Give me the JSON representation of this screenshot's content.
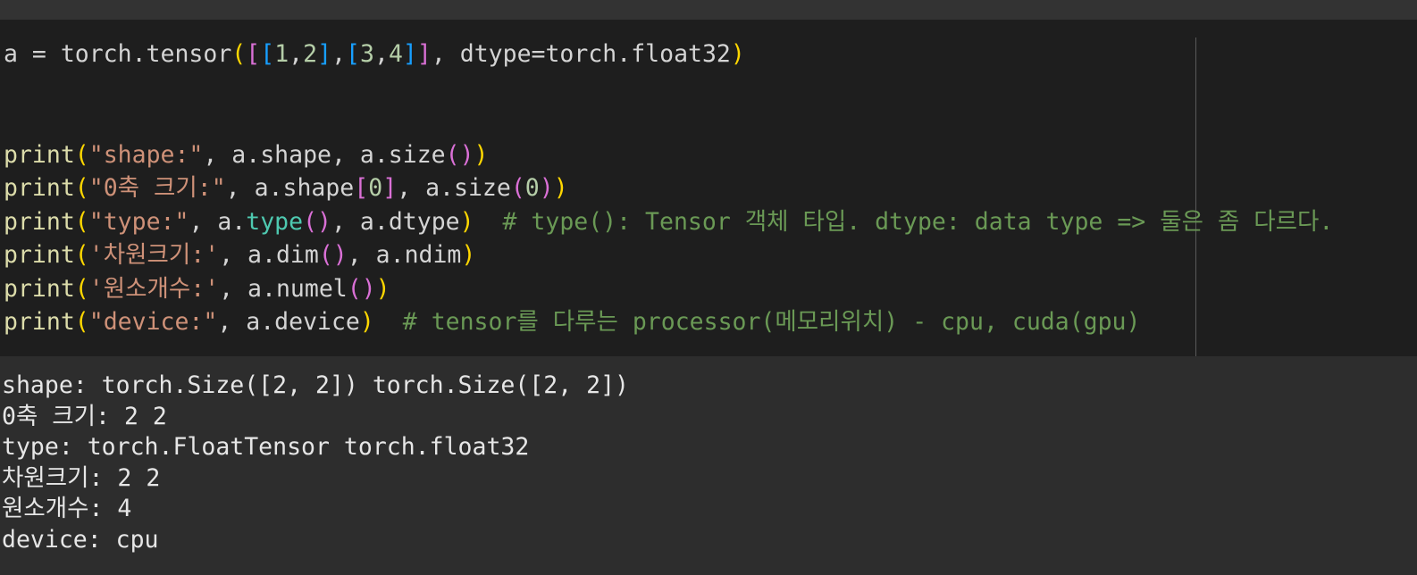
{
  "code_lines": [
    [
      {
        "t": "a = torch.tensor",
        "c": "txt"
      },
      {
        "t": "(",
        "c": "p1"
      },
      {
        "t": "[",
        "c": "p2"
      },
      {
        "t": "[",
        "c": "p3"
      },
      {
        "t": "1",
        "c": "num"
      },
      {
        "t": ",",
        "c": "txt"
      },
      {
        "t": "2",
        "c": "num"
      },
      {
        "t": "]",
        "c": "p3"
      },
      {
        "t": ",",
        "c": "txt"
      },
      {
        "t": "[",
        "c": "p3"
      },
      {
        "t": "3",
        "c": "num"
      },
      {
        "t": ",",
        "c": "txt"
      },
      {
        "t": "4",
        "c": "num"
      },
      {
        "t": "]",
        "c": "p3"
      },
      {
        "t": "]",
        "c": "p2"
      },
      {
        "t": ", dtype=torch.float32",
        "c": "txt"
      },
      {
        "t": ")",
        "c": "p1"
      }
    ],
    [],
    [],
    [
      {
        "t": "print",
        "c": "fn"
      },
      {
        "t": "(",
        "c": "p1"
      },
      {
        "t": "\"shape:\"",
        "c": "str"
      },
      {
        "t": ", a.shape, a.size",
        "c": "txt"
      },
      {
        "t": "()",
        "c": "p2"
      },
      {
        "t": ")",
        "c": "p1"
      }
    ],
    [
      {
        "t": "print",
        "c": "fn"
      },
      {
        "t": "(",
        "c": "p1"
      },
      {
        "t": "\"0축 크기:\"",
        "c": "str"
      },
      {
        "t": ", a.shape",
        "c": "txt"
      },
      {
        "t": "[",
        "c": "p2"
      },
      {
        "t": "0",
        "c": "num"
      },
      {
        "t": "]",
        "c": "p2"
      },
      {
        "t": ", a.size",
        "c": "txt"
      },
      {
        "t": "(",
        "c": "p2"
      },
      {
        "t": "0",
        "c": "num"
      },
      {
        "t": ")",
        "c": "p2"
      },
      {
        "t": ")",
        "c": "p1"
      }
    ],
    [
      {
        "t": "print",
        "c": "fn"
      },
      {
        "t": "(",
        "c": "p1"
      },
      {
        "t": "\"type:\"",
        "c": "str"
      },
      {
        "t": ", a.",
        "c": "txt"
      },
      {
        "t": "type",
        "c": "cls"
      },
      {
        "t": "()",
        "c": "p2"
      },
      {
        "t": ", a.dtype",
        "c": "txt"
      },
      {
        "t": ")",
        "c": "p1"
      },
      {
        "t": "  ",
        "c": "txt"
      },
      {
        "t": "# type(): Tensor 객체 타입. dtype: data type => 둘은 좀 다르다.",
        "c": "cmt"
      }
    ],
    [
      {
        "t": "print",
        "c": "fn"
      },
      {
        "t": "(",
        "c": "p1"
      },
      {
        "t": "'차원크기:'",
        "c": "str"
      },
      {
        "t": ", a.dim",
        "c": "txt"
      },
      {
        "t": "()",
        "c": "p2"
      },
      {
        "t": ", a.ndim",
        "c": "txt"
      },
      {
        "t": ")",
        "c": "p1"
      }
    ],
    [
      {
        "t": "print",
        "c": "fn"
      },
      {
        "t": "(",
        "c": "p1"
      },
      {
        "t": "'원소개수:'",
        "c": "str"
      },
      {
        "t": ", a.numel",
        "c": "txt"
      },
      {
        "t": "()",
        "c": "p2"
      },
      {
        "t": ")",
        "c": "p1"
      }
    ],
    [
      {
        "t": "print",
        "c": "fn"
      },
      {
        "t": "(",
        "c": "p1"
      },
      {
        "t": "\"device:\"",
        "c": "str"
      },
      {
        "t": ", a.device",
        "c": "txt"
      },
      {
        "t": ")",
        "c": "p1"
      },
      {
        "t": "  ",
        "c": "txt"
      },
      {
        "t": "# tensor를 다루는 processor(메모리위치) - cpu, cuda(gpu)",
        "c": "cmt"
      }
    ]
  ],
  "output_lines": [
    "shape: torch.Size([2, 2]) torch.Size([2, 2])",
    "0축 크기: 2 2",
    "type: torch.FloatTensor torch.float32",
    "차원크기: 2 2",
    "원소개수: 4",
    "device: cpu"
  ],
  "colors": {
    "editor_bg": "#1e1e1e",
    "output_bg": "#2d2d2d",
    "function": "#dcdcaa",
    "string": "#ce9178",
    "comment": "#6a9955",
    "number": "#b5cea8",
    "bracket_1": "#ffd700",
    "bracket_2": "#da70d6",
    "bracket_3": "#179fff"
  }
}
